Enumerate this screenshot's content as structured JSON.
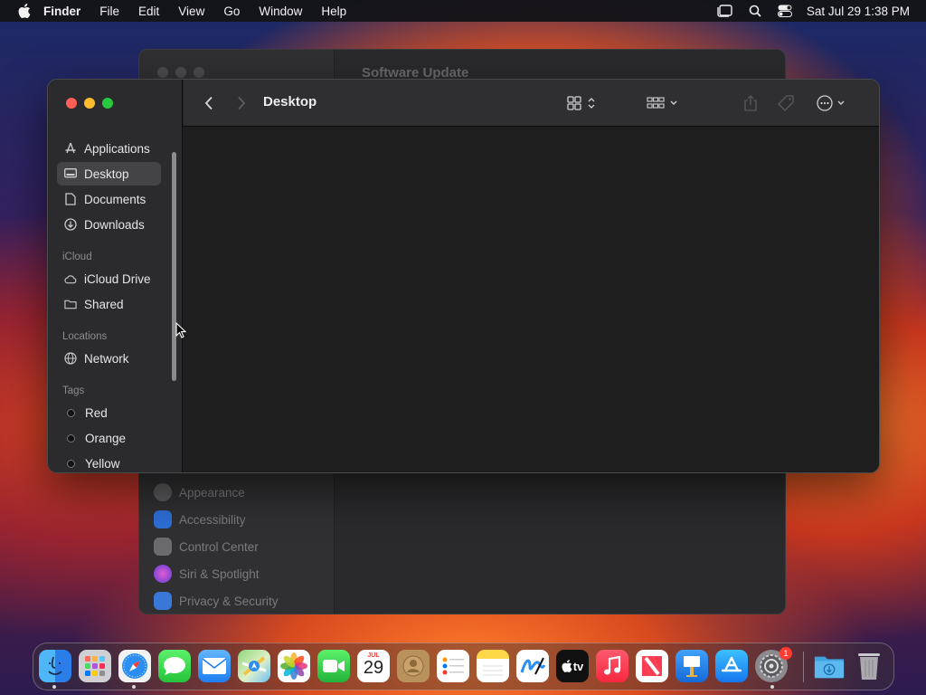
{
  "menubar": {
    "app_name": "Finder",
    "menus": [
      "File",
      "Edit",
      "View",
      "Go",
      "Window",
      "Help"
    ],
    "clock": "Sat Jul 29  1:38 PM"
  },
  "background_window": {
    "title": "Software Update",
    "items": [
      {
        "label": "Appearance",
        "icon": "appearance-icon",
        "color": "#5a5a5c"
      },
      {
        "label": "Accessibility",
        "icon": "accessibility-icon",
        "color": "#2d6fd6"
      },
      {
        "label": "Control Center",
        "icon": "control-center-icon",
        "color": "#6b6b6e"
      },
      {
        "label": "Siri & Spotlight",
        "icon": "siri-icon",
        "color": "#b04ad6"
      },
      {
        "label": "Privacy & Security",
        "icon": "hand-icon",
        "color": "#3a78d8"
      }
    ]
  },
  "finder": {
    "title": "Desktop",
    "sidebar": {
      "favorites": [
        {
          "label": "Applications",
          "icon": "applications-icon"
        },
        {
          "label": "Desktop",
          "icon": "desktop-icon",
          "active": true
        },
        {
          "label": "Documents",
          "icon": "document-icon"
        },
        {
          "label": "Downloads",
          "icon": "download-icon"
        }
      ],
      "icloud_header": "iCloud",
      "icloud": [
        {
          "label": "iCloud Drive",
          "icon": "cloud-icon"
        },
        {
          "label": "Shared",
          "icon": "shared-folder-icon"
        }
      ],
      "locations_header": "Locations",
      "locations": [
        {
          "label": "Network",
          "icon": "globe-icon"
        }
      ],
      "tags_header": "Tags",
      "tags": [
        {
          "label": "Red"
        },
        {
          "label": "Orange"
        },
        {
          "label": "Yellow"
        }
      ]
    }
  },
  "dock": {
    "apps": [
      "Finder",
      "Launchpad",
      "Safari",
      "Messages",
      "Mail",
      "Maps",
      "Photos",
      "FaceTime",
      "Calendar",
      "Contacts",
      "Reminders",
      "Notes",
      "Freeform",
      "TV",
      "Music",
      "News",
      "Keynote",
      "App Store",
      "System Settings",
      "Downloads",
      "Trash"
    ],
    "calendar_month": "JUL",
    "calendar_day": "29",
    "settings_badge": "1",
    "tv_label": "tv"
  },
  "colors": {
    "close": "#ff5f57",
    "minimize": "#febc2e",
    "zoom": "#28c840"
  }
}
